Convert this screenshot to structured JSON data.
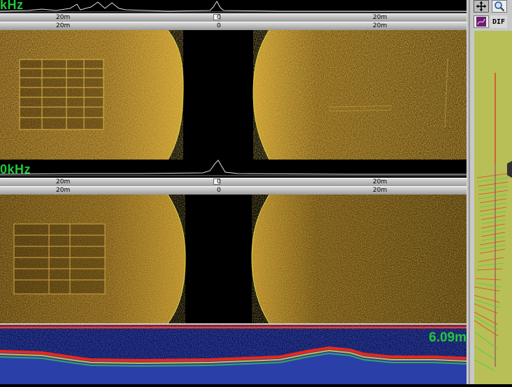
{
  "panel_top": {
    "freq_label": "kHz",
    "ruler_upper": {
      "left": "20m",
      "center": "0",
      "right": "20m"
    },
    "ruler_lower": {
      "left": "20m",
      "center": "0",
      "right": "20m"
    }
  },
  "panel_bottom": {
    "freq_label": "0kHz",
    "ruler_upper": {
      "left": "20m",
      "center": "0",
      "right": "20m"
    },
    "ruler_lower": {
      "left": "20m",
      "center": "0",
      "right": "20m"
    }
  },
  "depth_panel": {
    "depth_readout": "6.09m"
  },
  "toolbar": {
    "move_icon": "move-icon",
    "zoom_icon": "zoom-icon",
    "track_icon": "track-icon",
    "dif_label": "DIF"
  },
  "colors": {
    "freq_label": "#22c83a",
    "depth_readout": "#22c83a",
    "sonar_gold": "#c89a2a",
    "track_line": "#e03020",
    "map_background": "#b7bf56"
  }
}
